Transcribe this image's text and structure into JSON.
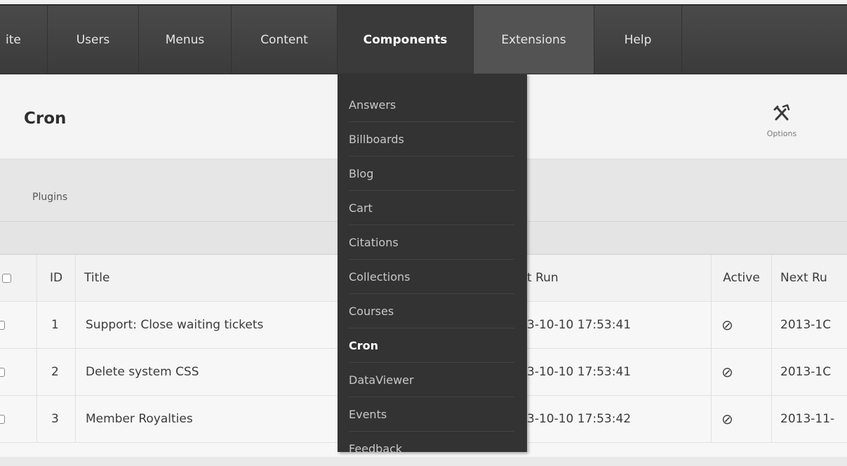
{
  "nav": {
    "items": [
      {
        "label": "ite"
      },
      {
        "label": "Users"
      },
      {
        "label": "Menus"
      },
      {
        "label": "Content"
      },
      {
        "label": "Components"
      },
      {
        "label": "Extensions"
      },
      {
        "label": "Help"
      }
    ],
    "active": "Components"
  },
  "header": {
    "title": "Cron",
    "options_label": "Options",
    "options_icon": "tools-icon"
  },
  "submenu": {
    "link": "Plugins"
  },
  "table": {
    "columns": [
      "",
      "ID",
      "Title",
      "t Run",
      "Active",
      "Next Ru"
    ],
    "rows": [
      {
        "id": "1",
        "title": "Support: Close waiting tickets",
        "last_run": "3-10-10 17:53:41",
        "active": "⊘",
        "next_run": "2013-1C"
      },
      {
        "id": "2",
        "title": "Delete system CSS",
        "last_run": "3-10-10 17:53:41",
        "active": "⊘",
        "next_run": "2013-1C"
      },
      {
        "id": "3",
        "title": "Member Royalties",
        "last_run": "3-10-10 17:53:42",
        "active": "⊘",
        "next_run": "2013-11-"
      }
    ]
  },
  "dropdown": {
    "items": [
      {
        "label": "Answers"
      },
      {
        "label": "Billboards"
      },
      {
        "label": "Blog"
      },
      {
        "label": "Cart"
      },
      {
        "label": "Citations"
      },
      {
        "label": "Collections"
      },
      {
        "label": "Courses"
      },
      {
        "label": "Cron"
      },
      {
        "label": "DataViewer"
      },
      {
        "label": "Events"
      },
      {
        "label": "Feedback"
      }
    ],
    "active": "Cron"
  },
  "colors": {
    "nav_bg": "#3f3f3f",
    "dropdown_bg": "#333333",
    "page_bg": "#e9e9e9"
  }
}
